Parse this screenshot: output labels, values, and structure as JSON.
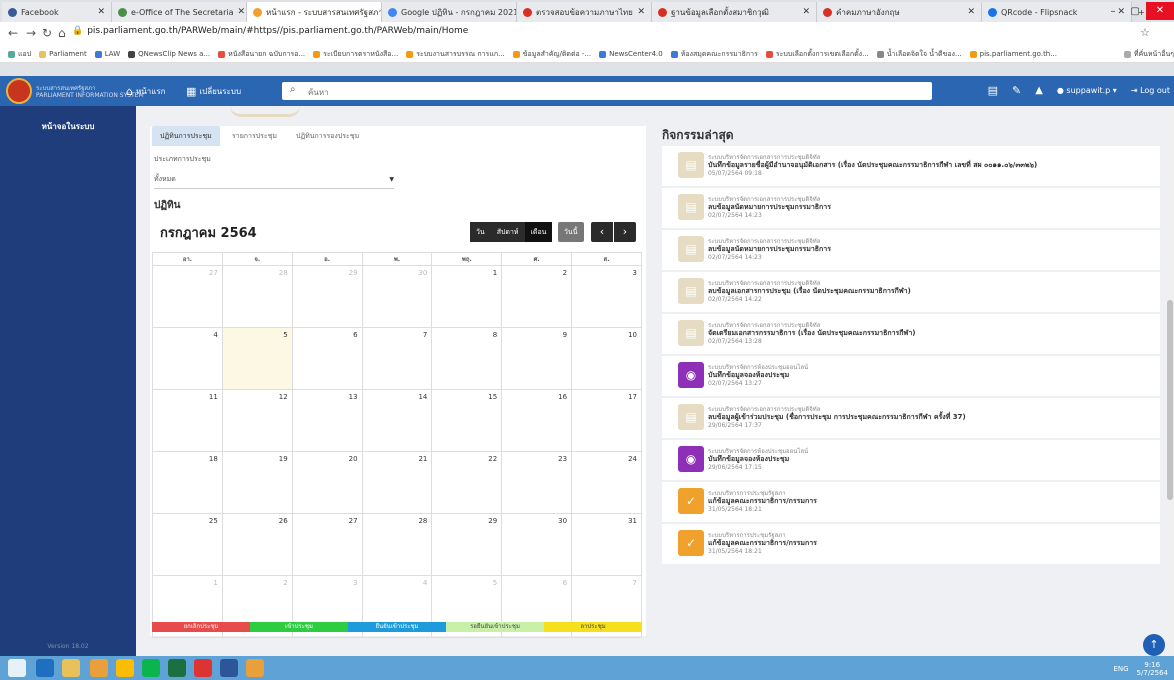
{
  "browser": {
    "tabs": [
      {
        "label": "Facebook",
        "color": "#3b5998"
      },
      {
        "label": "e-Office of The Secretaria",
        "color": "#4a8f4a"
      },
      {
        "label": "หน้าแรก - ระบบสารสนเทศรัฐสภา",
        "color": "#f0a12c",
        "active": true
      },
      {
        "label": "Google ปฏิทิน - กรกฎาคม 2021",
        "color": "#4285f4"
      },
      {
        "label": "ตรวจสอบข้อความภาษาไทย",
        "color": "#d93025"
      },
      {
        "label": "ฐานข้อมูลเลือกตั้งสมาชิกวุฒิ",
        "color": "#d93025"
      },
      {
        "label": "คำคมภาษาอังกฤษ",
        "color": "#d93025"
      },
      {
        "label": "QRcode - Flipsnack",
        "color": "#1a73e8"
      }
    ],
    "url_prefix": "pis.parliament.go.th",
    "url_path": "/PARWeb/main/#https//pis.parliament.go.th/PARWeb/main/Home",
    "bookmarks": [
      "แอป",
      "Parliament",
      "LAW",
      "QNewsClip News a...",
      "หนังสือนายก ฉบับการอ...",
      "ระเบียบการตราหนังสือ...",
      "ระบบงานสารบรรณ การแก...",
      "ข้อมูลสำคัญ/ติดต่อ -...",
      "NewsCenter4.0",
      "ห้องสมุดคณะกรรมาธิการ",
      "ระบบเลือกตั้งการเขตเลือกตั้ง...",
      "น้ำเลือดจิตใจ น้ำดีของ...",
      "pis.parliament.go.th...",
      "ที่คั่นหน้าอื่นๆ"
    ]
  },
  "header": {
    "logo_text_1": "ระบบสารสนเทศรัฐสภา",
    "logo_text_2": "PARLIAMENT INFORMATION SYSTEM",
    "home_label": "หน้าแรก",
    "apps_label": "เปลี่ยนระบบ",
    "search_placeholder": "ค้นหา",
    "user_label": "suppawit.p",
    "logout_label": "Log out"
  },
  "sidebar": {
    "home_label": "หน้าจอในระบบ",
    "version": "Version 18.02"
  },
  "calendar": {
    "tabs": [
      "ปฏิทินการประชุม",
      "รายการประชุม",
      "ปฏิทินการรองประชุม"
    ],
    "type_label": "ประเภทการประชุม",
    "type_value": "ทั้งหมด",
    "heading": "ปฏิทิน",
    "month_title": "กรกฎาคม 2564",
    "view_day": "วัน",
    "view_week": "สัปดาห์",
    "view_month": "เดือน",
    "today_label": "วันนี้",
    "weekdays": [
      "อา.",
      "จ.",
      "อ.",
      "พ.",
      "พฤ.",
      "ศ.",
      "ส."
    ],
    "weeks": [
      [
        "27",
        "28",
        "29",
        "30",
        "1",
        "2",
        "3"
      ],
      [
        "4",
        "5",
        "6",
        "7",
        "8",
        "9",
        "10"
      ],
      [
        "11",
        "12",
        "13",
        "14",
        "15",
        "16",
        "17"
      ],
      [
        "18",
        "19",
        "20",
        "21",
        "22",
        "23",
        "24"
      ],
      [
        "25",
        "26",
        "27",
        "28",
        "29",
        "30",
        "31"
      ],
      [
        "1",
        "2",
        "3",
        "4",
        "5",
        "6",
        "7"
      ]
    ],
    "legend": [
      {
        "label": "ยกเลิกประชุม",
        "color": "#e74c4c"
      },
      {
        "label": "เข้าประชุม",
        "color": "#2ecc40"
      },
      {
        "label": "ยืนยันเข้าประชุม",
        "color": "#1e9bdc"
      },
      {
        "label": "รอยืนยันเข้าประชุม",
        "color": "#c8f0a8"
      },
      {
        "label": "ลาประชุม",
        "color": "#f4e01c"
      }
    ]
  },
  "activity": {
    "title": "กิจกรรมล่าสุด",
    "items": [
      {
        "system": "ระบบบริหารจัดการเอกสารการประชุมดิจิทัล",
        "text": "บันทึกข้อมูลรายชื่อผู้มีอำนาจอนุมัติเอกสาร (เรื่อง นัดประชุมคณะกรรมาธิการกีฬา เลขที่ สผ ๐๐๑๑.๐๖/๓๓๒๖)",
        "date": "05/07/2564 09:18",
        "icon": "doc",
        "color": "#e6dcc4"
      },
      {
        "system": "ระบบบริหารจัดการเอกสารการประชุมดิจิทัล",
        "text": "ลบข้อมูลนัดหมายการประชุมกรรมาธิการ",
        "date": "02/07/2564 14:23",
        "icon": "doc",
        "color": "#e6dcc4"
      },
      {
        "system": "ระบบบริหารจัดการเอกสารการประชุมดิจิทัล",
        "text": "ลบข้อมูลนัดหมายการประชุมกรรมาธิการ",
        "date": "02/07/2564 14:23",
        "icon": "doc",
        "color": "#e6dcc4"
      },
      {
        "system": "ระบบบริหารจัดการเอกสารการประชุมดิจิทัล",
        "text": "ลบข้อมูลเอกสารการประชุม (เรื่อง นัดประชุมคณะกรรมาธิการกีฬา)",
        "date": "02/07/2564 14:22",
        "icon": "doc",
        "color": "#e6dcc4"
      },
      {
        "system": "ระบบบริหารจัดการเอกสารการประชุมดิจิทัล",
        "text": "จัดเตรียมเอกสารกรรมาธิการ (เรื่อง นัดประชุมคณะกรรมาธิการกีฬา)",
        "date": "02/07/2564 13:28",
        "icon": "doc",
        "color": "#e6dcc4"
      },
      {
        "system": "ระบบบริหารจัดการห้องประชุมออนไลน์",
        "text": "บันทึกข้อมูลจองห้องประชุม",
        "date": "02/07/2564 13:27",
        "icon": "room",
        "color": "#8e2fb7"
      },
      {
        "system": "ระบบบริหารจัดการเอกสารการประชุมดิจิทัล",
        "text": "ลบข้อมูลผู้เข้าร่วมประชุม (ชื่อการประชุม การประชุมคณะกรรมาธิการกีฬา ครั้งที่ 37)",
        "date": "29/06/2564 17:37",
        "icon": "doc",
        "color": "#e6dcc4"
      },
      {
        "system": "ระบบบริหารจัดการห้องประชุมออนไลน์",
        "text": "บันทึกข้อมูลจองห้องประชุม",
        "date": "29/06/2564 17:15",
        "icon": "room",
        "color": "#8e2fb7"
      },
      {
        "system": "ระบบบริหารการประชุมรัฐสภา",
        "text": "แก้ข้อมูลคณะกรรมาธิการ/กรรมการ",
        "date": "31/05/2564 18:21",
        "icon": "user",
        "color": "#f0a12c"
      },
      {
        "system": "ระบบบริหารการประชุมรัฐสภา",
        "text": "แก้ข้อมูลคณะกรรมาธิการ/กรรมการ",
        "date": "31/05/2564 18:21",
        "icon": "user",
        "color": "#f0a12c"
      }
    ]
  },
  "taskbar": {
    "clock_time": "9:16",
    "clock_date": "5/7/2564",
    "lang": "ENG"
  }
}
